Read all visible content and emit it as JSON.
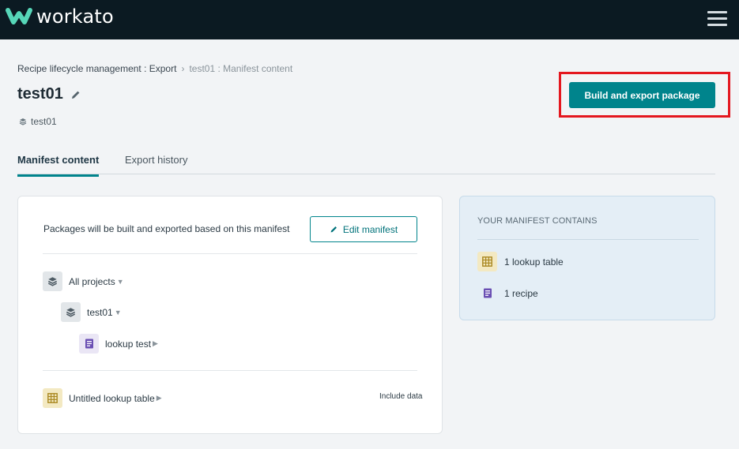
{
  "app": {
    "name": "workato"
  },
  "breadcrumb": {
    "parent": "Recipe lifecycle management : Export",
    "current": "test01 : Manifest content"
  },
  "page": {
    "title": "test01",
    "project": "test01"
  },
  "actions": {
    "build_export": "Build and export package"
  },
  "tabs": [
    {
      "label": "Manifest content",
      "active": true
    },
    {
      "label": "Export history",
      "active": false
    }
  ],
  "manifest": {
    "intro": "Packages will be built and exported based on this manifest",
    "edit_label": "Edit manifest",
    "tree": {
      "all_projects": "All projects",
      "project": "test01",
      "recipe": "lookup test"
    },
    "lookup_table": "Untitled lookup table",
    "include_data": "Include data"
  },
  "summary": {
    "heading": "YOUR MANIFEST CONTAINS",
    "items": [
      {
        "label": "1 lookup table",
        "icon": "table-icon"
      },
      {
        "label": "1 recipe",
        "icon": "recipe-icon"
      }
    ]
  },
  "colors": {
    "topbar": "#0b1a22",
    "accent": "#00848c",
    "highlight": "#e4171f",
    "recipe_icon": "#6a4fb3",
    "table_icon": "#a9871f"
  }
}
